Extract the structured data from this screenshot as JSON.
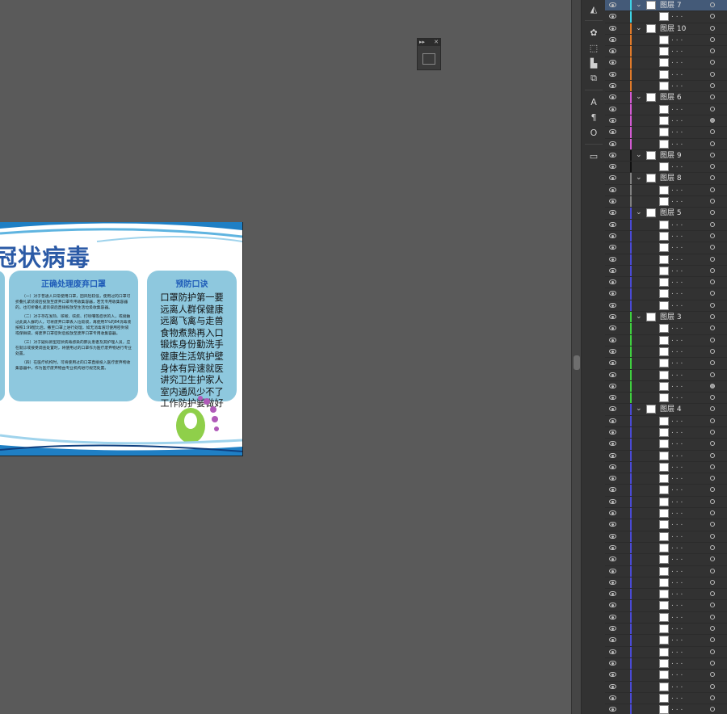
{
  "document": {
    "title": "冠状病毒",
    "panel_left_heading": "正确处理废弃口罩",
    "panel_left_paragraphs": [
      "（一）对于普通人日常使用口罩，因风险较低，使用过的口罩可折叠扎紧装袋后投放至废弃口罩专用收集容器，若无专用收集容器的，也可折叠扎紧装袋后直接投放至生活垃圾收集容器。",
      "（二）对于存在发热、咳嗽、咳痰、打喷嚏等症状的人，或接触过此类人群的人，可将废弃口罩丢入垃圾袋，再使用5%的84消毒液按照1:99配比后，撒至口罩上进行处理，如无消毒液可使用密封袋或保鲜袋，将废弃口罩密封后投放至废弃口罩专用收集容器。",
      "（三）对于疑似新型冠状病毒感染的肺炎患者及其护理人员，应在就诊或接受调查处置时，将使用过的口罩作为医疗废弃物进行专业处置。",
      "（四）在医疗机构时，可将使用过的口罩直接投入医疗废弃物收集容器中，作为医疗废弃物由专业机构进行规范处置。"
    ],
    "panel_right_heading": "预防口诀",
    "panel_right_lines": [
      "口罩防护第一要",
      "远离人群保健康",
      "远离飞禽与走兽",
      "食物煮熟再入口",
      "锻炼身份勤洗手",
      "健康生活筑护壁",
      "身体有异速就医",
      "讲究卫生护家人",
      "室内通风少不了",
      "工作防护要做好"
    ]
  },
  "layers": [
    {
      "type": "group",
      "name": "图层 7",
      "color": "#3fd3e6",
      "selected": true
    },
    {
      "type": "child",
      "color": "#3fd3e6"
    },
    {
      "type": "group",
      "name": "图层 10",
      "color": "#e07a2a"
    },
    {
      "type": "child",
      "color": "#e07a2a"
    },
    {
      "type": "child",
      "color": "#e07a2a"
    },
    {
      "type": "child",
      "color": "#e07a2a"
    },
    {
      "type": "child",
      "color": "#e07a2a"
    },
    {
      "type": "child",
      "color": "#e07a2a"
    },
    {
      "type": "group",
      "name": "图层 6",
      "color": "#d25ad2"
    },
    {
      "type": "child",
      "color": "#d25ad2"
    },
    {
      "type": "child",
      "color": "#d25ad2",
      "filled": true
    },
    {
      "type": "child",
      "color": "#d25ad2"
    },
    {
      "type": "child",
      "color": "#d25ad2"
    },
    {
      "type": "group",
      "name": "图层 9",
      "color": "#111111"
    },
    {
      "type": "child",
      "color": "#111111"
    },
    {
      "type": "group",
      "name": "图层 8",
      "color": "#808080"
    },
    {
      "type": "child",
      "color": "#808080"
    },
    {
      "type": "child",
      "color": "#808080"
    },
    {
      "type": "group",
      "name": "图层 5",
      "color": "#4a4ad6"
    },
    {
      "type": "child",
      "color": "#4a4ad6"
    },
    {
      "type": "child",
      "color": "#4a4ad6"
    },
    {
      "type": "child",
      "color": "#4a4ad6"
    },
    {
      "type": "child",
      "color": "#4a4ad6"
    },
    {
      "type": "child",
      "color": "#4a4ad6"
    },
    {
      "type": "child",
      "color": "#4a4ad6"
    },
    {
      "type": "child",
      "color": "#4a4ad6"
    },
    {
      "type": "child",
      "color": "#4a4ad6"
    },
    {
      "type": "group",
      "name": "图层 3",
      "color": "#3fcf3f"
    },
    {
      "type": "child",
      "color": "#3fcf3f"
    },
    {
      "type": "child",
      "color": "#3fcf3f"
    },
    {
      "type": "child",
      "color": "#3fcf3f"
    },
    {
      "type": "child",
      "color": "#3fcf3f"
    },
    {
      "type": "child",
      "color": "#3fcf3f"
    },
    {
      "type": "child",
      "color": "#3fcf3f",
      "filled": true
    },
    {
      "type": "child",
      "color": "#3fcf3f"
    },
    {
      "type": "group",
      "name": "图层 4",
      "color": "#4a4ad6"
    },
    {
      "type": "child",
      "color": "#4a4ad6"
    },
    {
      "type": "child",
      "color": "#4a4ad6"
    },
    {
      "type": "child",
      "color": "#4a4ad6"
    },
    {
      "type": "child",
      "color": "#4a4ad6"
    },
    {
      "type": "child",
      "color": "#4a4ad6"
    },
    {
      "type": "child",
      "color": "#4a4ad6"
    },
    {
      "type": "child",
      "color": "#4a4ad6"
    },
    {
      "type": "child",
      "color": "#4a4ad6"
    },
    {
      "type": "child",
      "color": "#4a4ad6"
    },
    {
      "type": "child",
      "color": "#4a4ad6"
    },
    {
      "type": "child",
      "color": "#4a4ad6"
    },
    {
      "type": "child",
      "color": "#4a4ad6"
    },
    {
      "type": "child",
      "color": "#4a4ad6"
    },
    {
      "type": "child",
      "color": "#4a4ad6"
    },
    {
      "type": "child",
      "color": "#4a4ad6"
    },
    {
      "type": "child",
      "color": "#4a4ad6"
    },
    {
      "type": "child",
      "color": "#4a4ad6"
    },
    {
      "type": "child",
      "color": "#4a4ad6"
    },
    {
      "type": "child",
      "color": "#4a4ad6"
    },
    {
      "type": "child",
      "color": "#4a4ad6"
    },
    {
      "type": "child",
      "color": "#4a4ad6"
    },
    {
      "type": "child",
      "color": "#4a4ad6"
    },
    {
      "type": "child",
      "color": "#4a4ad6"
    },
    {
      "type": "child",
      "color": "#4a4ad6"
    },
    {
      "type": "child",
      "color": "#4a4ad6"
    },
    {
      "type": "child",
      "color": "#4a4ad6"
    }
  ],
  "ui": {
    "child_suffix": ". . .",
    "mini_panel_left": "▸▸",
    "mini_panel_right": "✕"
  },
  "tools": [
    "shape-builder-icon",
    "symbol-icon",
    "transform-icon",
    "align-icon",
    "pathfinder-icon",
    "character-icon",
    "paragraph-icon",
    "opentype-icon",
    "gradient-icon"
  ]
}
